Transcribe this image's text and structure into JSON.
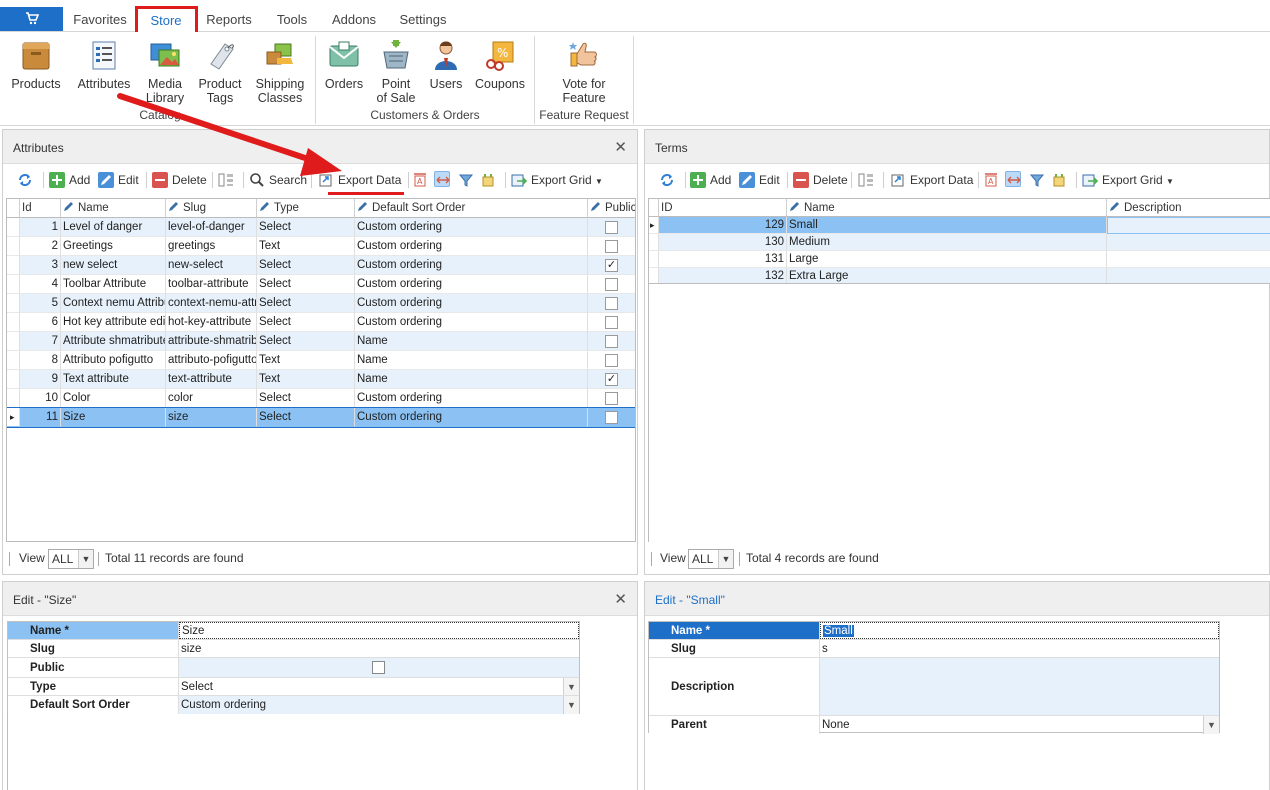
{
  "tabs": {
    "app_icon": "cart-icon",
    "items": [
      "Favorites",
      "Store",
      "Reports",
      "Tools",
      "Addons",
      "Settings"
    ],
    "active": "Store"
  },
  "ribbon": {
    "catalog_group": "Catalog",
    "customers_group": "Customers & Orders",
    "feature_group": "Feature Request",
    "products": "Products",
    "attributes": "Attributes",
    "media_library_1": "Media",
    "media_library_2": "Library",
    "product_tags_1": "Product",
    "product_tags_2": "Tags",
    "shipping_classes_1": "Shipping",
    "shipping_classes_2": "Classes",
    "orders": "Orders",
    "pos_1": "Point",
    "pos_2": "of Sale",
    "users": "Users",
    "coupons": "Coupons",
    "vote_1": "Vote for",
    "vote_2": "Feature"
  },
  "attributes_panel": {
    "title": "Attributes",
    "toolbar": {
      "add": "Add",
      "edit": "Edit",
      "delete": "Delete",
      "search": "Search",
      "export_data": "Export Data",
      "export_grid": "Export Grid"
    },
    "columns": [
      "Id",
      "Name",
      "Slug",
      "Type",
      "Default Sort Order",
      "Public"
    ],
    "rows": [
      {
        "id": "1",
        "name": "Level of danger",
        "slug": "level-of-danger",
        "type": "Select",
        "sort": "Custom ordering",
        "public": ""
      },
      {
        "id": "2",
        "name": "Greetings",
        "slug": "greetings",
        "type": "Text",
        "sort": "Custom ordering",
        "public": ""
      },
      {
        "id": "3",
        "name": "new select",
        "slug": "new-select",
        "type": "Select",
        "sort": "Custom ordering",
        "public": "✓"
      },
      {
        "id": "4",
        "name": "Toolbar Attribute",
        "slug": "toolbar-attribute",
        "type": "Select",
        "sort": "Custom ordering",
        "public": ""
      },
      {
        "id": "5",
        "name": "Context nemu Attribu",
        "slug": "context-nemu-attr",
        "type": "Select",
        "sort": "Custom ordering",
        "public": ""
      },
      {
        "id": "6",
        "name": "Hot key attribute edi",
        "slug": "hot-key-attribute",
        "type": "Select",
        "sort": "Custom ordering",
        "public": ""
      },
      {
        "id": "7",
        "name": "Attribute shmatribute",
        "slug": "attribute-shmatrib",
        "type": "Select",
        "sort": "Name",
        "public": ""
      },
      {
        "id": "8",
        "name": "Attributo pofigutto",
        "slug": "attributo-pofigutto",
        "type": "Text",
        "sort": "Name",
        "public": ""
      },
      {
        "id": "9",
        "name": "Text attribute",
        "slug": "text-attribute",
        "type": "Text",
        "sort": "Name",
        "public": "✓"
      },
      {
        "id": "10",
        "name": "Color",
        "slug": "color",
        "type": "Select",
        "sort": "Custom ordering",
        "public": ""
      },
      {
        "id": "11",
        "name": "Size",
        "slug": "size",
        "type": "Select",
        "sort": "Custom ordering",
        "public": ""
      }
    ],
    "view_label": "View",
    "view_value": "ALL",
    "total": "Total 11 records are found"
  },
  "terms_panel": {
    "title": "Terms",
    "toolbar": {
      "add": "Add",
      "edit": "Edit",
      "delete": "Delete",
      "export_data": "Export Data",
      "export_grid": "Export Grid"
    },
    "columns": [
      "ID",
      "Name",
      "Description"
    ],
    "rows": [
      {
        "id": "129",
        "name": "Small",
        "description": ""
      },
      {
        "id": "130",
        "name": "Medium",
        "description": ""
      },
      {
        "id": "131",
        "name": "Large",
        "description": ""
      },
      {
        "id": "132",
        "name": "Extra Large",
        "description": ""
      }
    ],
    "view_label": "View",
    "view_value": "ALL",
    "total": "Total 4 records are found"
  },
  "edit_size": {
    "title": "Edit - \"Size\"",
    "fields": {
      "name_label": "Name *",
      "name_value": "Size",
      "slug_label": "Slug",
      "slug_value": "size",
      "public_label": "Public",
      "type_label": "Type",
      "type_value": "Select",
      "sort_label": "Default Sort Order",
      "sort_value": "Custom ordering"
    }
  },
  "edit_small": {
    "title": "Edit - \"Small\"",
    "fields": {
      "name_label": "Name *",
      "name_value": "Small",
      "slug_label": "Slug",
      "slug_value": "s",
      "desc_label": "Description",
      "desc_value": "",
      "parent_label": "Parent",
      "parent_value": "None"
    }
  },
  "colors": {
    "accent": "#1e6fc8",
    "highlight_red": "#e01b1b",
    "row_alt": "#e6f1fb",
    "row_selected": "#8bc2f3"
  }
}
